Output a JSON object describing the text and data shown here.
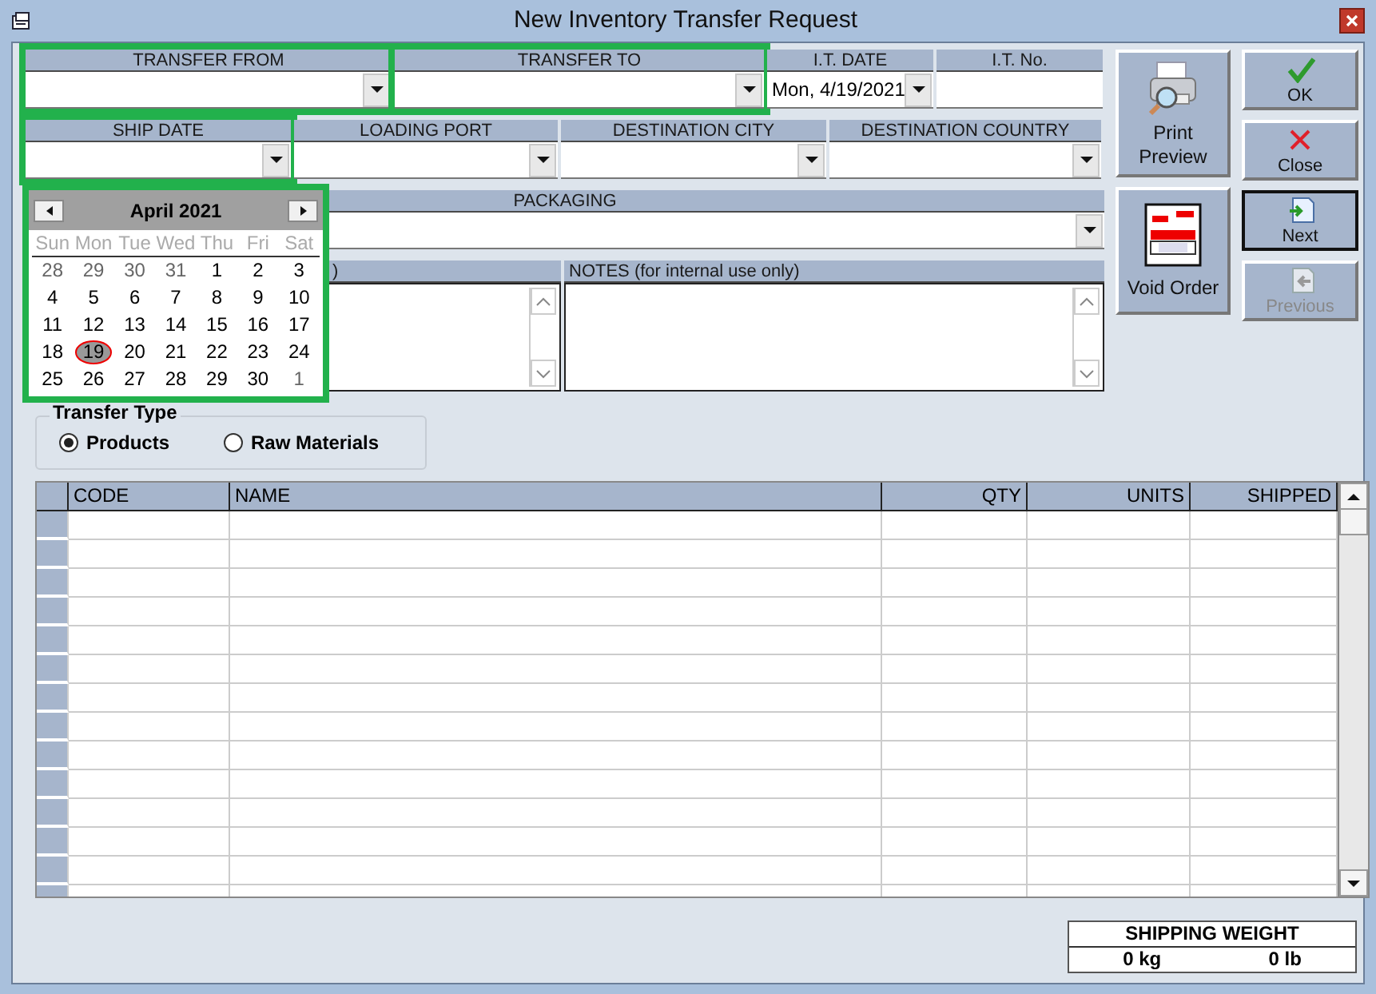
{
  "window": {
    "title": "New Inventory Transfer Request"
  },
  "row_1": [
    {
      "label": "TRANSFER FROM",
      "kind": "combo",
      "highlighted": true
    },
    {
      "label": "TRANSFER TO",
      "kind": "combo",
      "highlighted": true
    },
    {
      "label": "I.T. DATE",
      "kind": "combo",
      "value": "Mon, 4/19/2021"
    },
    {
      "label": "I.T. No.",
      "kind": "text"
    }
  ],
  "row_2": [
    {
      "label": "SHIP DATE",
      "kind": "combo",
      "highlighted": true
    },
    {
      "label": "LOADING PORT",
      "kind": "combo"
    },
    {
      "label": "DESTINATION CITY",
      "kind": "combo"
    },
    {
      "label": "DESTINATION COUNTRY",
      "kind": "combo"
    }
  ],
  "row_3": [
    {
      "label": "PACKAGING",
      "kind": "combo"
    }
  ],
  "row_4": [
    {
      "label": ")",
      "kind": "memo"
    },
    {
      "label": "NOTES (for internal use only)",
      "kind": "memo"
    }
  ],
  "calendar": {
    "month": "April 2021",
    "highlighted": true,
    "weekdays": [
      "Sun",
      "Mon",
      "Tue",
      "Wed",
      "Thu",
      "Fri",
      "Sat"
    ],
    "days": [
      {
        "day": "28",
        "muted": true,
        "selected": false
      },
      {
        "day": "29",
        "muted": true,
        "selected": false
      },
      {
        "day": "30",
        "muted": true,
        "selected": false
      },
      {
        "day": "31",
        "muted": true,
        "selected": false
      },
      {
        "day": "1",
        "muted": false,
        "selected": false
      },
      {
        "day": "2",
        "muted": false,
        "selected": false
      },
      {
        "day": "3",
        "muted": false,
        "selected": false
      },
      {
        "day": "4",
        "muted": false,
        "selected": false
      },
      {
        "day": "5",
        "muted": false,
        "selected": false
      },
      {
        "day": "6",
        "muted": false,
        "selected": false
      },
      {
        "day": "7",
        "muted": false,
        "selected": false
      },
      {
        "day": "8",
        "muted": false,
        "selected": false
      },
      {
        "day": "9",
        "muted": false,
        "selected": false
      },
      {
        "day": "10",
        "muted": false,
        "selected": false
      },
      {
        "day": "11",
        "muted": false,
        "selected": false
      },
      {
        "day": "12",
        "muted": false,
        "selected": false
      },
      {
        "day": "13",
        "muted": false,
        "selected": false
      },
      {
        "day": "14",
        "muted": false,
        "selected": false
      },
      {
        "day": "15",
        "muted": false,
        "selected": false
      },
      {
        "day": "16",
        "muted": false,
        "selected": false
      },
      {
        "day": "17",
        "muted": false,
        "selected": false
      },
      {
        "day": "18",
        "muted": false,
        "selected": false
      },
      {
        "day": "19",
        "muted": false,
        "selected": true
      },
      {
        "day": "20",
        "muted": false,
        "selected": false
      },
      {
        "day": "21",
        "muted": false,
        "selected": false
      },
      {
        "day": "22",
        "muted": false,
        "selected": false
      },
      {
        "day": "23",
        "muted": false,
        "selected": false
      },
      {
        "day": "24",
        "muted": false,
        "selected": false
      },
      {
        "day": "25",
        "muted": false,
        "selected": false
      },
      {
        "day": "26",
        "muted": false,
        "selected": false
      },
      {
        "day": "27",
        "muted": false,
        "selected": false
      },
      {
        "day": "28",
        "muted": false,
        "selected": false
      },
      {
        "day": "29",
        "muted": false,
        "selected": false
      },
      {
        "day": "30",
        "muted": false,
        "selected": false
      },
      {
        "day": "1",
        "muted": true,
        "selected": false
      }
    ]
  },
  "big_buttons": [
    {
      "label": "Print Preview",
      "kind": "print"
    },
    {
      "label": "Void Order",
      "kind": "void"
    }
  ],
  "small_buttons": [
    {
      "label": "OK",
      "kind": "ok",
      "disabled": false,
      "focused": false
    },
    {
      "label": "Close",
      "kind": "close",
      "disabled": false,
      "focused": false
    },
    {
      "label": "Next",
      "kind": "next",
      "disabled": false,
      "focused": true
    },
    {
      "label": "Previous",
      "kind": "previous",
      "disabled": true,
      "focused": false
    }
  ],
  "transfer_type": {
    "title": "Transfer Type",
    "options": [
      {
        "label": "Products",
        "selected": true
      },
      {
        "label": "Raw Materials",
        "selected": false
      }
    ]
  },
  "table": {
    "columns": [
      {
        "label": "CODE"
      },
      {
        "label": "NAME"
      },
      {
        "label": "QTY"
      },
      {
        "label": "UNITS"
      },
      {
        "label": "SHIPPED"
      }
    ]
  },
  "shipping_weight": {
    "title": "SHIPPING WEIGHT",
    "kg": "0 kg",
    "lb": "0 lb"
  }
}
